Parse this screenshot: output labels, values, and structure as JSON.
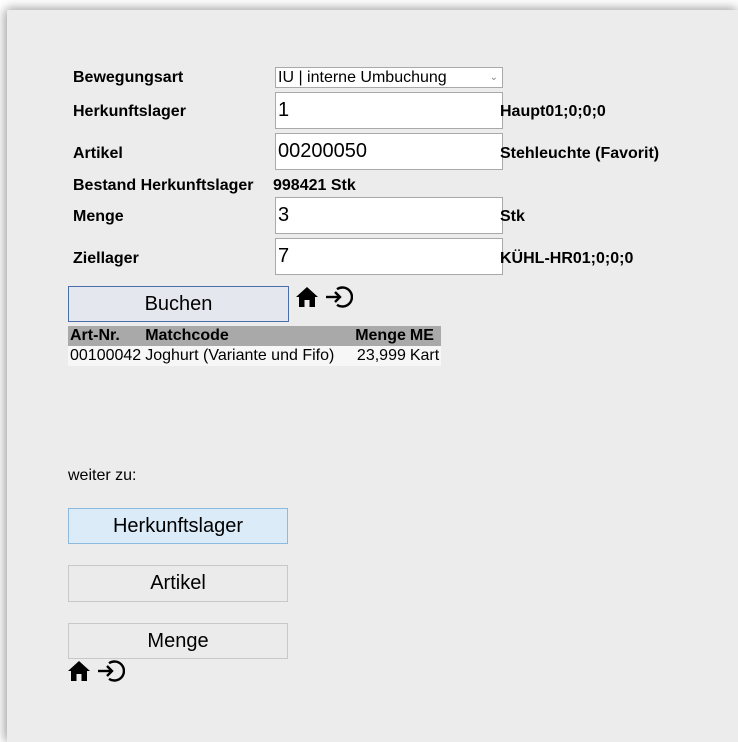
{
  "form": {
    "bewegungsart": {
      "label": "Bewegungsart",
      "value": "IU | interne Umbuchung"
    },
    "herkunftslager": {
      "label": "Herkunftslager",
      "value": "1",
      "info": "Haupt01;0;0;0"
    },
    "artikel": {
      "label": "Artikel",
      "value": "00200050",
      "info": "Stehleuchte (Favorit)"
    },
    "bestand": {
      "label": "Bestand Herkunftslager",
      "value": "998421 Stk"
    },
    "menge": {
      "label": "Menge",
      "value": "3",
      "info": "Stk"
    },
    "ziellager": {
      "label": "Ziellager",
      "value": "7",
      "info": "KÜHL-HR01;0;0;0"
    }
  },
  "actions": {
    "buchen_label": "Buchen"
  },
  "table": {
    "headers": [
      "Art-Nr.",
      "Matchcode",
      "Menge",
      "ME"
    ],
    "rows": [
      [
        "00100042",
        "Joghurt (Variante und Fifo)",
        "23,999",
        "Kart"
      ]
    ]
  },
  "weiter": {
    "label": "weiter zu:",
    "buttons": [
      "Herkunftslager",
      "Artikel",
      "Menge"
    ]
  },
  "icons": [
    "home-icon",
    "logout-icon"
  ],
  "colors": {
    "background": "#ececec",
    "header": "#a9a9a9",
    "active_button": "#dbebf7",
    "primary_border": "#4a6fa8"
  }
}
